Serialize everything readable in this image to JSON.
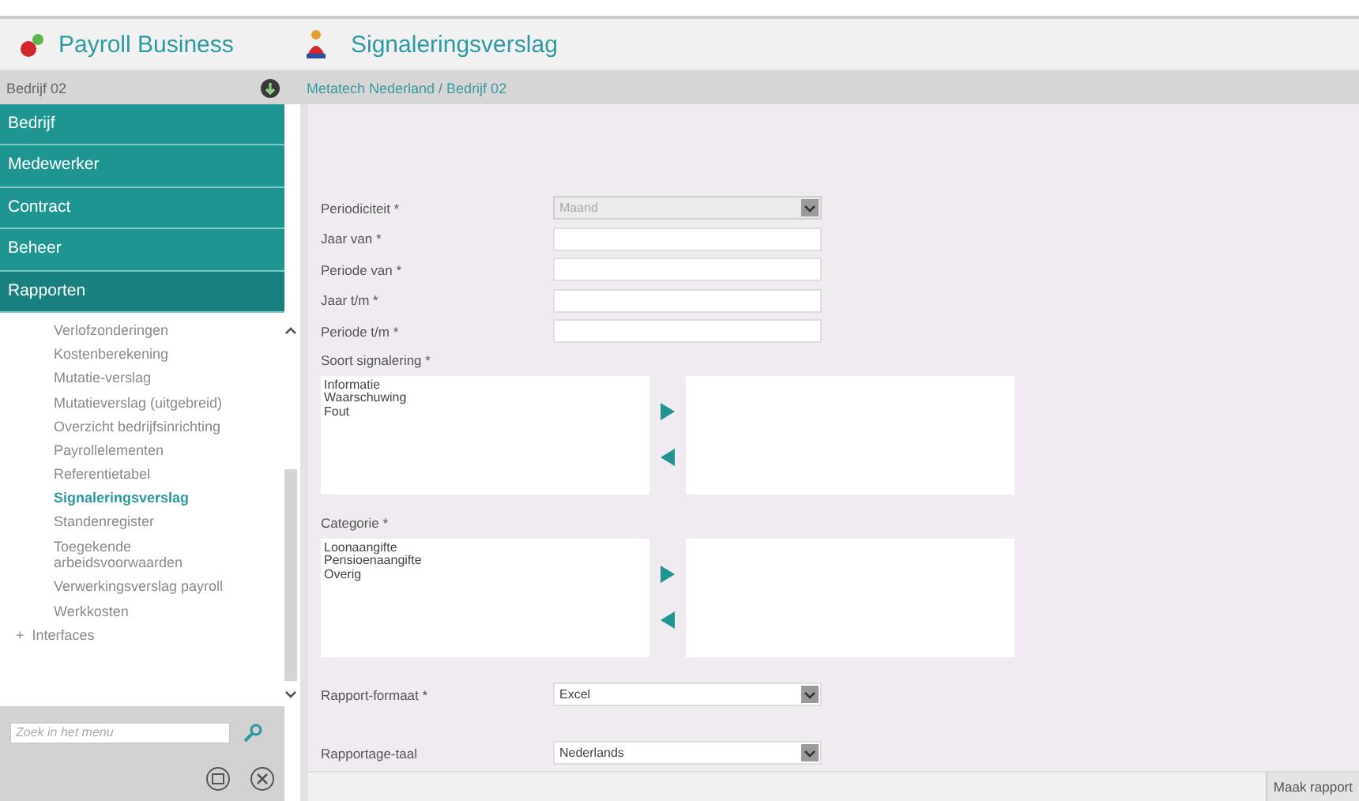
{
  "app": {
    "name": "Payroll Business"
  },
  "page": {
    "title": "Signaleringsverslag"
  },
  "company": {
    "name": "Bedrijf 02"
  },
  "breadcrumb": "Metatech Nederland / Bedrijf 02",
  "menu": [
    {
      "label": "Bedrijf",
      "selected": false
    },
    {
      "label": "Medewerker",
      "selected": false
    },
    {
      "label": "Contract",
      "selected": false
    },
    {
      "label": "Beheer",
      "selected": false
    },
    {
      "label": "Rapporten",
      "selected": true
    }
  ],
  "submenu": [
    {
      "label": "Verlofzonderingen",
      "selected": false
    },
    {
      "label": "Kostenberekening",
      "selected": false
    },
    {
      "label": "Mutatie-verslag",
      "selected": false
    },
    {
      "label": "Mutatieverslag (uitgebreid)",
      "selected": false
    },
    {
      "label": "Overzicht bedrijfsinrichting",
      "selected": false
    },
    {
      "label": "Payrollelementen",
      "selected": false
    },
    {
      "label": "Referentietabel",
      "selected": false
    },
    {
      "label": "Signaleringsverslag",
      "selected": true
    },
    {
      "label": "Standenregister",
      "selected": false
    },
    {
      "label": "Toegekende arbeidsvoorwaarden",
      "selected": false
    },
    {
      "label": "Verwerkingsverslag payroll",
      "selected": false
    },
    {
      "label": "Werkkosten",
      "selected": false
    }
  ],
  "submenu_group": {
    "expander": "+",
    "label": "Interfaces"
  },
  "menu_search": {
    "placeholder": "Zoek in het menu"
  },
  "form": {
    "fields": [
      {
        "kind": "select",
        "label": "Periodiciteit *",
        "value": "Maand",
        "disabled": true
      },
      {
        "kind": "text",
        "label": "Jaar van *",
        "disabled": false
      },
      {
        "kind": "text",
        "label": "Periode van *",
        "disabled": false
      },
      {
        "kind": "text",
        "label": "Jaar t/m *",
        "disabled": false
      },
      {
        "kind": "text",
        "label": "Periode t/m *",
        "disabled": false
      }
    ],
    "pickers": [
      {
        "label": "Soort signalering *",
        "available": [
          "Informatie",
          "Waarschuwing",
          "Fout"
        ]
      },
      {
        "label": "Categorie *",
        "available": [
          "Loonaangifte",
          "Pensioenaangifte",
          "Overig"
        ]
      }
    ],
    "options": [
      {
        "label": "Rapport-formaat *",
        "value": "Excel"
      },
      {
        "label": "Rapportage-taal",
        "value": "Nederlands"
      }
    ]
  },
  "footer": {
    "button": "Maak rapport"
  }
}
